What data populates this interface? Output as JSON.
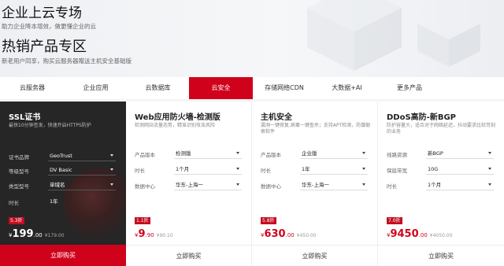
{
  "hero": {
    "title": "企业上云专场",
    "subtitle": "助力企业降本增效，做更懂企业的云",
    "hot_title": "热销产品专区",
    "hot_subtitle": "新老用户同享，购买云服务器赠送主机安全基础版"
  },
  "tabs": [
    {
      "label": "云服务器"
    },
    {
      "label": "企业应用"
    },
    {
      "label": "云数据库"
    },
    {
      "label": "云安全"
    },
    {
      "label": "存储网络CDN"
    },
    {
      "label": "大数据+AI"
    },
    {
      "label": "更多产品"
    }
  ],
  "active_tab": "云安全",
  "colors": {
    "accent": "#d0021b",
    "dark_card": "#262626"
  },
  "cards": [
    {
      "title": "SSL证书",
      "desc": "最快10分钟签发，快速开启HTTPS防护",
      "rows": [
        {
          "label": "证书品牌",
          "value": "GeoTrust"
        },
        {
          "label": "等级型号",
          "value": "DV Basic"
        },
        {
          "label": "类型型号",
          "value": "单域名"
        },
        {
          "label": "时长",
          "value": "1年"
        }
      ],
      "discount": "5.3折",
      "currency": "¥",
      "price_int": "199",
      "price_dec": ".00",
      "orig": "¥179.00",
      "buy": "立即购买"
    },
    {
      "title": "Web应用防火墙-检测版",
      "desc": "检测网站流量态势，精准识别攻击风险",
      "rows": [
        {
          "label": "产品版本",
          "value": "检测版"
        },
        {
          "label": "时长",
          "value": "1个月"
        },
        {
          "label": "数据中心",
          "value": "华东-上海一"
        }
      ],
      "discount": "1.1折",
      "currency": "¥",
      "price_int": "9",
      "price_dec": ".90",
      "orig": "¥90.10",
      "buy": "立即购买"
    },
    {
      "title": "主机安全",
      "desc": "漏洞一键修复,病毒一键查杀；支持APT检测，防御勒索软件",
      "rows": [
        {
          "label": "产品版本",
          "value": "企业版"
        },
        {
          "label": "时长",
          "value": "1年"
        },
        {
          "label": "数据中心",
          "value": "华东-上海一"
        }
      ],
      "discount": "5.8折",
      "currency": "¥",
      "price_int": "630",
      "price_dec": ".00",
      "orig": "¥450.00",
      "buy": "立即购买"
    },
    {
      "title": "DDoS高防-新BGP",
      "desc": "防护容量大，适合对于网络延迟，抖动要求比较苛刻的业务",
      "rows": [
        {
          "label": "线路资源",
          "value": "新BGP"
        },
        {
          "label": "保底带宽",
          "value": "10G"
        },
        {
          "label": "时长",
          "value": "1个月"
        }
      ],
      "discount": "7.0折",
      "currency": "¥",
      "price_int": "9450",
      "price_dec": ".00",
      "orig": "¥4050.00",
      "buy": "立即购买"
    }
  ]
}
